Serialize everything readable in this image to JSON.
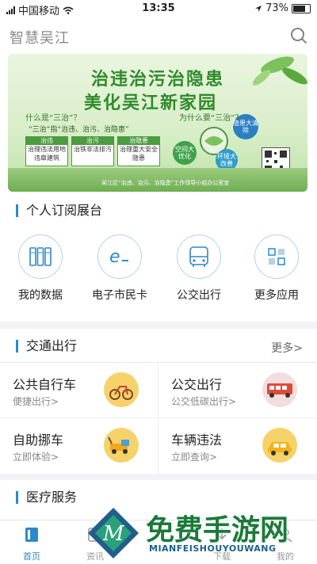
{
  "status_bar": {
    "carrier": "中国移动",
    "time": "13:35",
    "battery": "73%"
  },
  "header": {
    "title": "智慧吴江",
    "search_icon": "search-icon"
  },
  "banner": {
    "title_line1": "治违治污治隐患",
    "title_line2": "美化吴江新家园",
    "q1": "什么是“三治”？",
    "q2": "为什么要“三治”？",
    "definition": "“三治”指“治违、治污、治隐患”",
    "boxes": [
      {
        "head": "治违",
        "body": "治理违法用地违章建筑"
      },
      {
        "head": "治污",
        "body": "治铁非法排污"
      },
      {
        "head": "治隐患",
        "body": "治理重大安全隐患"
      }
    ],
    "circles": [
      "空间大优化",
      "环境大改善",
      "隐患大清除"
    ],
    "footer": "吴江区“治违、治污、治隐患”工作领导小组办公室宣"
  },
  "subscription": {
    "title": "个人订阅展台"
  },
  "apps": [
    {
      "label": "我的数据",
      "icon": "database-icon"
    },
    {
      "label": "电子市民卡",
      "icon": "ecard-icon"
    },
    {
      "label": "公交出行",
      "icon": "bus-icon"
    },
    {
      "label": "更多应用",
      "icon": "grid-icon"
    }
  ],
  "traffic": {
    "title": "交通出行",
    "more": "更多>",
    "cells": [
      {
        "title": "公共自行车",
        "sub": "便捷出行>",
        "icon": "bicycle-icon"
      },
      {
        "title": "公交出行",
        "sub": "公交低碳出行>",
        "icon": "bus-icon"
      },
      {
        "title": "自助挪车",
        "sub": "立即体验>",
        "icon": "tow-truck-icon"
      },
      {
        "title": "车辆违法",
        "sub": "立即查询>",
        "icon": "taxi-icon"
      }
    ]
  },
  "medical": {
    "title": "医疗服务"
  },
  "tabbar": [
    {
      "label": "首页",
      "icon": "home-icon"
    },
    {
      "label": "资讯",
      "icon": "news-icon"
    },
    {
      "label": "下载",
      "icon": "download-icon"
    },
    {
      "label": "我的",
      "icon": "user-icon"
    }
  ],
  "watermark": {
    "main": "免费手游网",
    "sub": "MIANFEISHOUYOUWANG"
  },
  "colors": {
    "accent": "#2c89c9",
    "banner_green": "#2f8a2c",
    "tab_active": "#2c89c9"
  }
}
